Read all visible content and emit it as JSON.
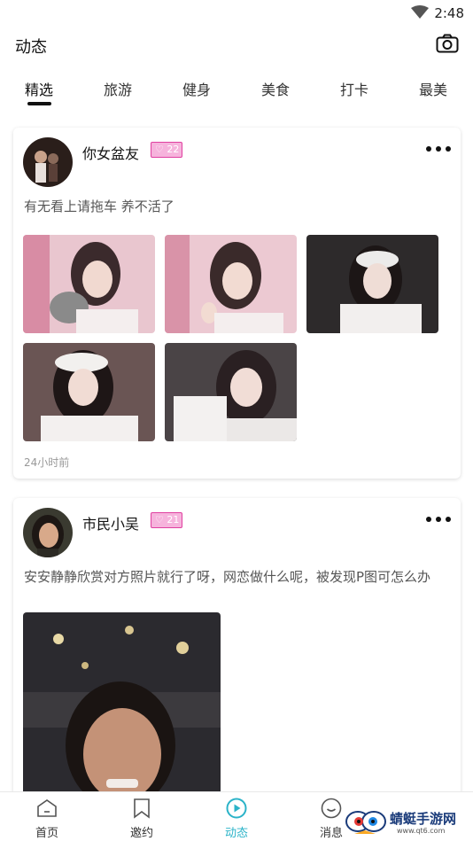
{
  "status_bar": {
    "time": "2:48"
  },
  "header": {
    "title": "动态"
  },
  "tabs": [
    {
      "label": "精选"
    },
    {
      "label": "旅游"
    },
    {
      "label": "健身"
    },
    {
      "label": "美食"
    },
    {
      "label": "打卡"
    },
    {
      "label": "最美"
    }
  ],
  "posts": [
    {
      "username": "你女盆友",
      "age": "22",
      "text": "有无看上请拖车  养不活了",
      "time": "24小时前"
    },
    {
      "username": "市民小吴",
      "age": "21",
      "text": "安安静静欣赏对方照片就行了呀，网恋做什么呢，被发现P图可怎么办"
    }
  ],
  "bottom_nav": [
    {
      "label": "首页",
      "icon": "home-icon"
    },
    {
      "label": "邀约",
      "icon": "bookmark-icon"
    },
    {
      "label": "动态",
      "icon": "play-circle-icon"
    },
    {
      "label": "消息",
      "icon": "chat-icon"
    }
  ],
  "watermark": {
    "text": "蜻蜓手游网",
    "sub": "www.qt6.com"
  },
  "colors": {
    "accent": "#2bb3c8",
    "badge_fill": "#f6b3dc",
    "badge_border": "#e040a0"
  }
}
